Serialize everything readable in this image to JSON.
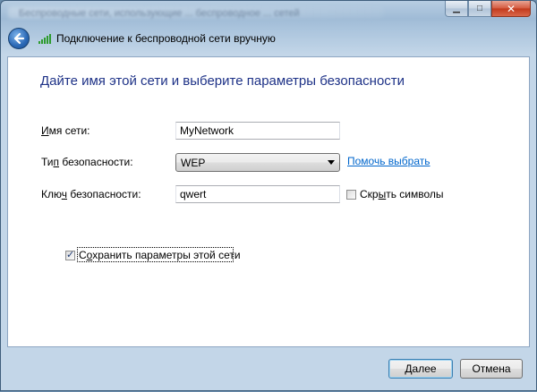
{
  "window": {
    "blurred_title": "Беспроводные сети, использующие ... беспроводное ... сетей"
  },
  "header": {
    "title": "Подключение к беспроводной сети вручную"
  },
  "main": {
    "instruction": "Дайте имя этой сети и выберите параметры безопасности",
    "network_name": {
      "label_underline": "И",
      "label_rest": "мя сети:",
      "value": "MyNetwork"
    },
    "security_type": {
      "label_pre": "Ти",
      "label_underline": "п",
      "label_rest": " безопасности:",
      "value": "WEP"
    },
    "help_link": "Помочь выбрать",
    "security_key": {
      "label_pre": "Клю",
      "label_underline": "ч",
      "label_rest": " безопасности:",
      "value": "qwert"
    },
    "hide_chars": {
      "label_pre": "Скр",
      "label_underline": "ы",
      "label_rest": "ть символы",
      "checked": false
    },
    "save_settings": {
      "label_pre": "С",
      "label_underline": "о",
      "label_rest": "хранить параметры этой сети",
      "checked": true
    }
  },
  "footer": {
    "next_underline": "Д",
    "next_rest": "алее",
    "cancel": "Отмена"
  }
}
